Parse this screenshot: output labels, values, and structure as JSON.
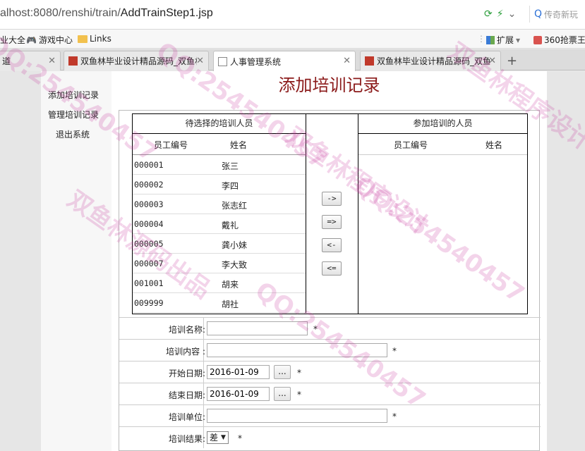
{
  "browser": {
    "url_prefix": "alhost:8080/renshi/train/",
    "url_page": "AddTrainStep1.jsp",
    "search_placeholder": "传奇新玩",
    "bookmarks": {
      "item1": "业大全",
      "item2": "游戏中心",
      "item3": "Links",
      "ext": "扩展",
      "ticket": "360抢票王"
    },
    "tabs": {
      "t1": "道",
      "t2": "双鱼林毕业设计精品源码_双鱼林",
      "t3": "人事管理系统",
      "t4": "双鱼林毕业设计精品源码_双鱼林"
    }
  },
  "sidebar": {
    "add": "添加培训记录",
    "manage": "管理培训记录",
    "logout": "退出系统"
  },
  "page_title": "添加培训记录",
  "selector": {
    "left_title": "待选择的培训人员",
    "right_title": "参加培训的人员",
    "col_id": "员工编号",
    "col_name": "姓名",
    "rcol_id": "员工编号",
    "rcol_name": "姓名",
    "employees": [
      {
        "id": "000001",
        "name": "张三"
      },
      {
        "id": "000002",
        "name": "李四"
      },
      {
        "id": "000003",
        "name": "张志红"
      },
      {
        "id": "000004",
        "name": "戴礼"
      },
      {
        "id": "000005",
        "name": "龚小妹"
      },
      {
        "id": "000007",
        "name": "李大致"
      },
      {
        "id": "001001",
        "name": "胡来"
      },
      {
        "id": "009999",
        "name": "胡社"
      }
    ],
    "btn_add_one": "->",
    "btn_add_all": "=>",
    "btn_remove_one": "<-",
    "btn_remove_all": "<="
  },
  "form": {
    "name_label": "培训名称:",
    "content_label": "培训内容 :",
    "start_label": "开始日期:",
    "start_value": "2016-01-09",
    "end_label": "结束日期:",
    "end_value": "2016-01-09",
    "unit_label": "培训单位:",
    "result_label": "培训结果:",
    "result_value": "差",
    "required": "*",
    "date_btn": "..."
  },
  "watermark": {
    "qq": "QQ:254540457",
    "cn1": "双鱼林源码出品",
    "cn2": "双鱼林程序设计"
  }
}
